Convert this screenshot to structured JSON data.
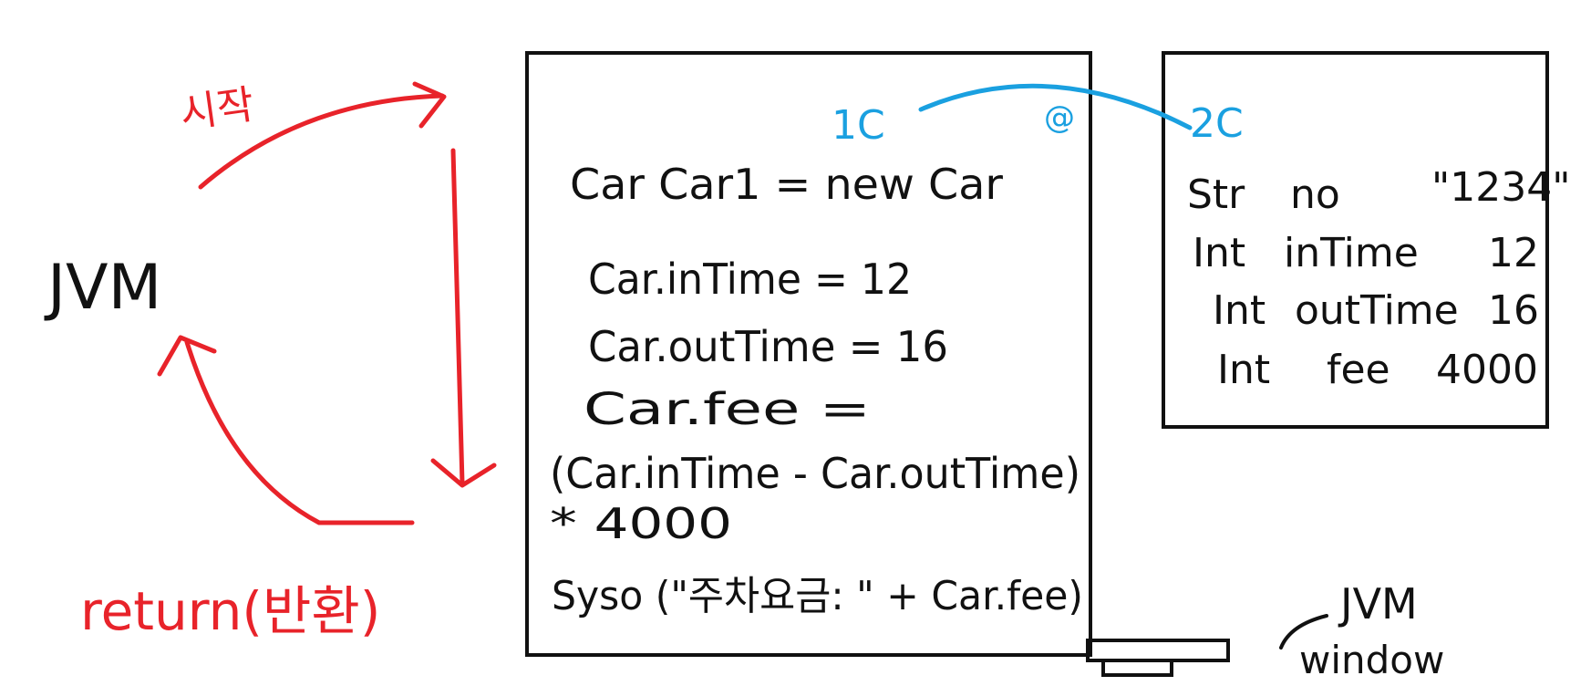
{
  "colors": {
    "ink": "#111111",
    "red": "#e8232a",
    "blue": "#1aa0e0"
  },
  "left": {
    "jvm_label": "JVM",
    "start_label": "시작",
    "return_label": "return(반환)"
  },
  "stack_box": {
    "address_label": "1C",
    "address_marker": "@",
    "lines": [
      "Car  Car1 = new Car",
      "Car.inTime = 12",
      "Car.outTime = 16",
      "Car.fee =",
      "(Car.inTime - Car.outTime)",
      "* 4000",
      "Syso (\"주차요금: \" + Car.fee)"
    ]
  },
  "heap_box": {
    "address_label": "2C",
    "fields": [
      {
        "type": "Str",
        "name": "no",
        "value": "\"1234\""
      },
      {
        "type": "Int",
        "name": "inTime",
        "value": "12"
      },
      {
        "type": "Int",
        "name": "outTime",
        "value": "16"
      },
      {
        "type": "Int",
        "name": "fee",
        "value": "4000"
      }
    ]
  },
  "jvm_window": {
    "line1": "JVM",
    "line2": "window"
  }
}
